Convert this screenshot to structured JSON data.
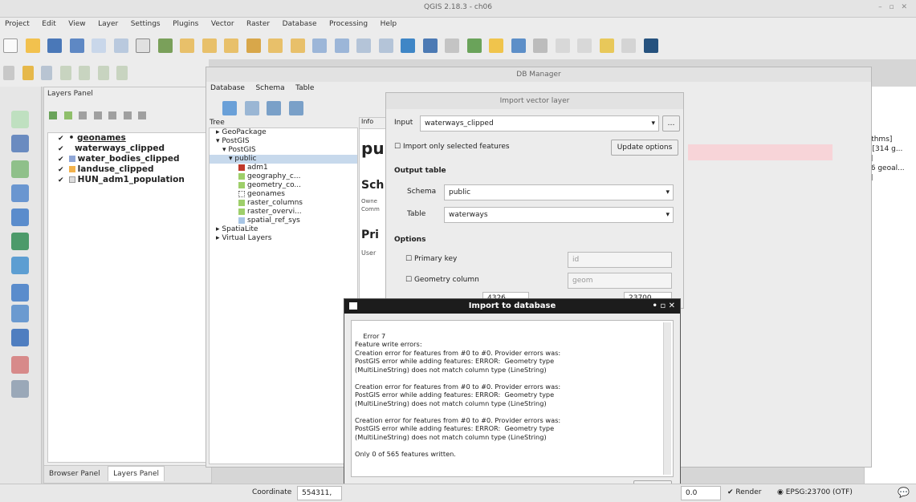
{
  "app": {
    "title": "QGIS 2.18.3 - ch06",
    "menu": [
      "Project",
      "Edit",
      "View",
      "Layer",
      "Settings",
      "Plugins",
      "Vector",
      "Raster",
      "Database",
      "Processing",
      "Help"
    ]
  },
  "layers_panel": {
    "title": "Layers Panel",
    "layers": [
      {
        "name": "geonames",
        "color": "#ffffff"
      },
      {
        "name": "waterways_clipped",
        "color": "#ffffff"
      },
      {
        "name": "water_bodies_clipped",
        "color": "#8fa6d6"
      },
      {
        "name": "landuse_clipped",
        "color": "#f2b24c"
      },
      {
        "name": "HUN_adm1_population",
        "color": "#dcdcdc"
      }
    ],
    "tabs": [
      "Browser Panel",
      "Layers Panel"
    ]
  },
  "db_manager": {
    "title": "DB Manager",
    "menu": [
      "Database",
      "Schema",
      "Table"
    ],
    "tree_label": "Tree",
    "tree": [
      "GeoPackage",
      "PostGIS",
      "PostGIS",
      "public",
      "adm1",
      "geography_c...",
      "geometry_co...",
      "geonames",
      "raster_columns",
      "raster_overvi...",
      "spatial_ref_sys",
      "SpatiaLite",
      "Virtual Layers"
    ],
    "info_tab": "Info",
    "info": {
      "heading": "pu",
      "section1": "Sch",
      "owner": "Owne",
      "comment": "Comm",
      "section2": "Pri",
      "user": "User"
    }
  },
  "right_panel": {
    "lines": [
      "rithms]",
      "s [314 g...",
      "s]",
      "16 geoal...",
      "s]"
    ]
  },
  "import_dialog": {
    "title": "Import vector layer",
    "input_label": "Input",
    "input_value": "waterways_clipped",
    "only_selected": "Import only selected features",
    "update_btn": "Update options",
    "output_table": "Output table",
    "schema_label": "Schema",
    "schema_value": "public",
    "table_label": "Table",
    "table_value": "waterways",
    "options": "Options",
    "primary_key": "Primary key",
    "primary_key_val": "id",
    "geom_col": "Geometry column",
    "geom_col_val": "geom",
    "src_srid_val": "4326",
    "tgt_srid_val": "23700"
  },
  "error_dialog": {
    "title": "Import to database",
    "text": "Error 7\nFeature write errors:\nCreation error for features from #0 to #0. Provider errors was:\nPostGIS error while adding features: ERROR:  Geometry type\n(MultiLineString) does not match column type (LineString)\n\nCreation error for features from #0 to #0. Provider errors was:\nPostGIS error while adding features: ERROR:  Geometry type\n(MultiLineString) does not match column type (LineString)\n\nCreation error for features from #0 to #0. Provider errors was:\nPostGIS error while adding features: ERROR:  Geometry type\n(MultiLineString) does not match column type (LineString)\n\nOnly 0 of 565 features written.",
    "close": "Close"
  },
  "status": {
    "coordinate_label": "Coordinate",
    "coordinate_value": "554311,",
    "rotation": "0.0",
    "render": "Render",
    "crs": "EPSG:23700 (OTF)"
  }
}
